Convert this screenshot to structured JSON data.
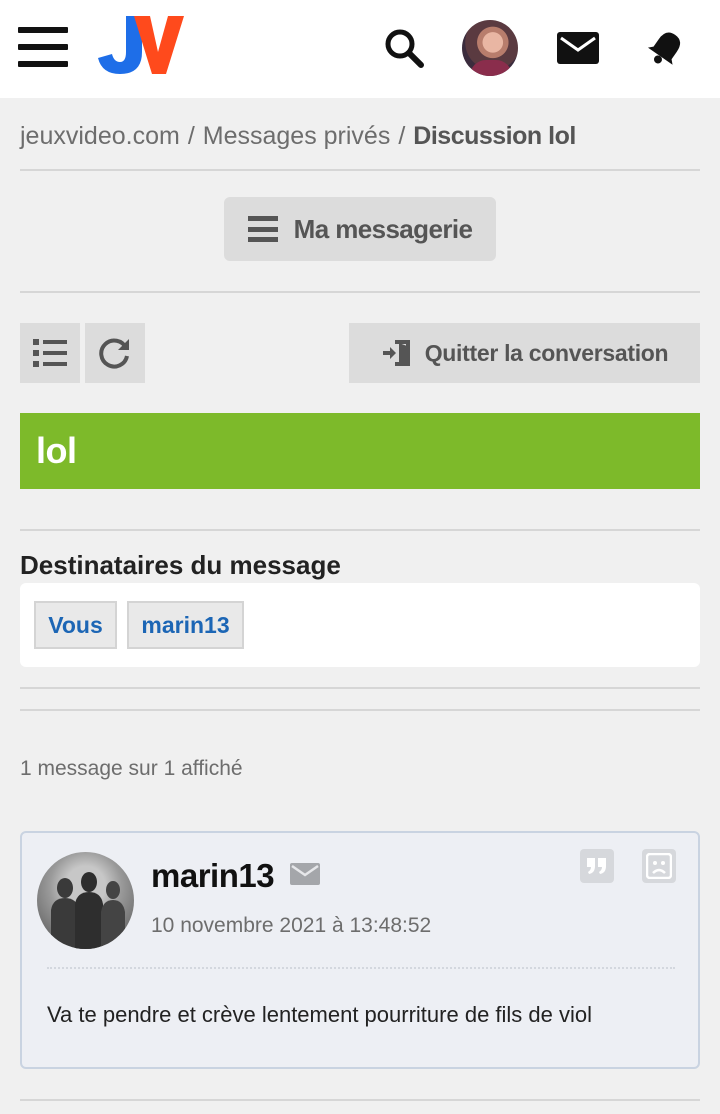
{
  "header": {
    "icons": [
      "menu-icon",
      "jv-logo",
      "search-icon",
      "user-avatar",
      "mail-icon",
      "bell-icon"
    ],
    "logo_text": "JV",
    "colors": {
      "logo_blue": "#1e6ee8",
      "logo_red": "#ff4a1c"
    }
  },
  "breadcrumb": {
    "site": "jeuxvideo.com",
    "section": "Messages privés",
    "current": "Discussion lol",
    "separator": "/"
  },
  "buttons": {
    "messagerie": "Ma messagerie",
    "quit": "Quitter la conversation"
  },
  "conversation": {
    "title": "lol",
    "title_color": "#7dba2a"
  },
  "recipients": {
    "heading": "Destinataires du message",
    "items": [
      "Vous",
      "marin13"
    ]
  },
  "message_count": "1 message sur 1 affiché",
  "messages": [
    {
      "author": "marin13",
      "date": "10 novembre 2021 à 13:48:52",
      "body": "Va te pendre et crève lentement pourriture de fils de viol"
    }
  ]
}
